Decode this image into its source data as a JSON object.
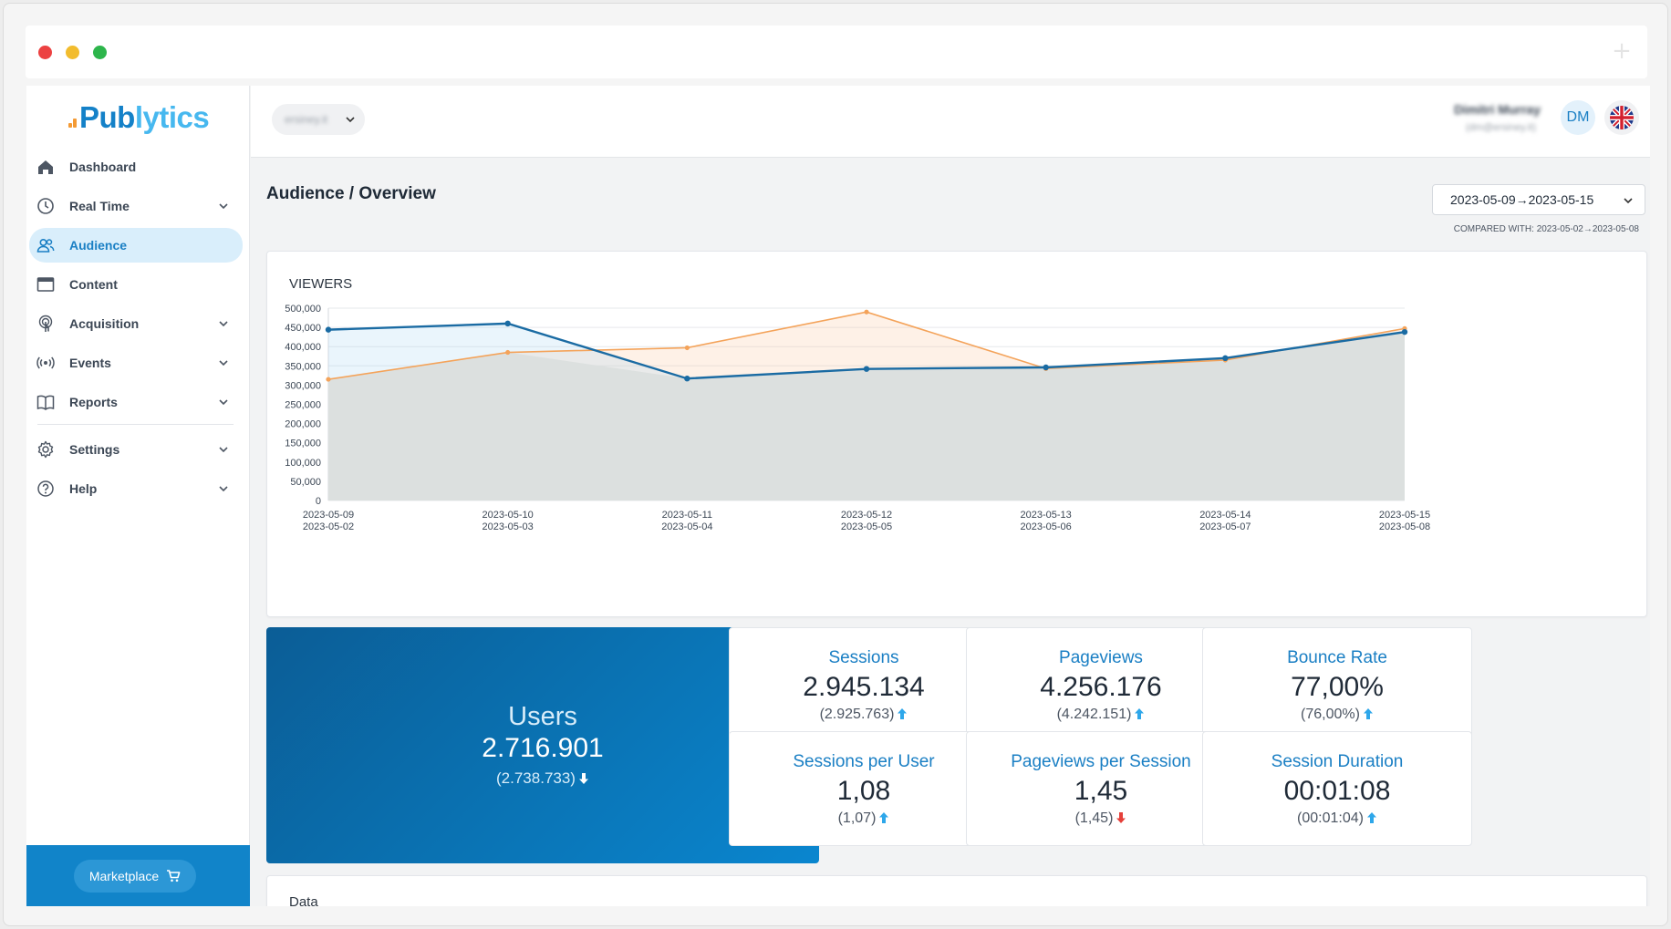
{
  "window": {
    "controls": [
      "close",
      "minimize",
      "maximize"
    ],
    "new_tab_glyph": "+"
  },
  "brand": {
    "logo_prefix": "Pub",
    "logo_suffix": "lytics"
  },
  "sidebar": {
    "items": [
      {
        "label": "Dashboard",
        "icon": "home-icon",
        "expandable": false,
        "active": false
      },
      {
        "label": "Real Time",
        "icon": "clock-icon",
        "expandable": true,
        "active": false
      },
      {
        "label": "Audience",
        "icon": "users-icon",
        "expandable": false,
        "active": true
      },
      {
        "label": "Content",
        "icon": "browser-window-icon",
        "expandable": false,
        "active": false
      },
      {
        "label": "Acquisition",
        "icon": "touch-icon",
        "expandable": true,
        "active": false
      },
      {
        "label": "Events",
        "icon": "broadcast-icon",
        "expandable": true,
        "active": false
      },
      {
        "label": "Reports",
        "icon": "book-icon",
        "expandable": true,
        "active": false
      },
      {
        "label": "Settings",
        "icon": "gear-icon",
        "expandable": true,
        "active": false
      },
      {
        "label": "Help",
        "icon": "help-circle-icon",
        "expandable": true,
        "active": false
      }
    ],
    "marketplace_label": "Marketplace"
  },
  "topbar": {
    "site_selector": "                 ",
    "user_name": "                 ",
    "user_email": "                    ",
    "avatar_initials": "DM",
    "language_flag": "uk-flag-icon"
  },
  "page": {
    "title": "Audience / Overview",
    "date_range": "2023-05-09→2023-05-15",
    "compared_with": "COMPARED WITH: 2023-05-02→2023-05-08"
  },
  "colors": {
    "accent": "#1a7fc4",
    "current_series": "#1a6ba3",
    "previous_series": "#f4a35a",
    "arrow_up": "#2ea7ea",
    "arrow_down_red": "#e5403a"
  },
  "chart_data": {
    "type": "line",
    "title": "VIEWERS",
    "x": [
      "2023-05-09",
      "2023-05-10",
      "2023-05-11",
      "2023-05-12",
      "2023-05-13",
      "2023-05-14",
      "2023-05-15"
    ],
    "x_secondary": [
      "2023-05-02",
      "2023-05-03",
      "2023-05-04",
      "2023-05-05",
      "2023-05-06",
      "2023-05-07",
      "2023-05-08"
    ],
    "series": [
      {
        "values": [
          444000,
          460000,
          317000,
          342000,
          346000,
          370000,
          438000
        ]
      },
      {
        "values": [
          315000,
          385000,
          397000,
          490000,
          343000,
          365000,
          447000
        ]
      }
    ],
    "ylim": [
      0,
      500000
    ],
    "yticks": [
      "500,000",
      "450,000",
      "400,000",
      "350,000",
      "300,000",
      "250,000",
      "200,000",
      "150,000",
      "100,000",
      "50,000",
      "0"
    ],
    "grid": true,
    "legend": "none"
  },
  "summary": {
    "users": {
      "label": "Users",
      "value": "2.716.901",
      "previous": "(2.738.733)",
      "trend": "down"
    },
    "metrics": [
      {
        "label": "Sessions",
        "value": "2.945.134",
        "previous": "(2.925.763)",
        "trend": "up",
        "trend_color": "blue"
      },
      {
        "label": "Pageviews",
        "value": "4.256.176",
        "previous": "(4.242.151)",
        "trend": "up",
        "trend_color": "blue"
      },
      {
        "label": "Bounce Rate",
        "value": "77,00%",
        "previous": "(76,00%)",
        "trend": "up",
        "trend_color": "blue"
      },
      {
        "label": "Sessions per User",
        "value": "1,08",
        "previous": "(1,07)",
        "trend": "up",
        "trend_color": "blue"
      },
      {
        "label": "Pageviews per Session",
        "value": "1,45",
        "previous": "(1,45)",
        "trend": "down",
        "trend_color": "red"
      },
      {
        "label": "Session Duration",
        "value": "00:01:08",
        "previous": "(00:01:04)",
        "trend": "up",
        "trend_color": "blue"
      }
    ]
  },
  "data_section": {
    "title": "Data"
  }
}
